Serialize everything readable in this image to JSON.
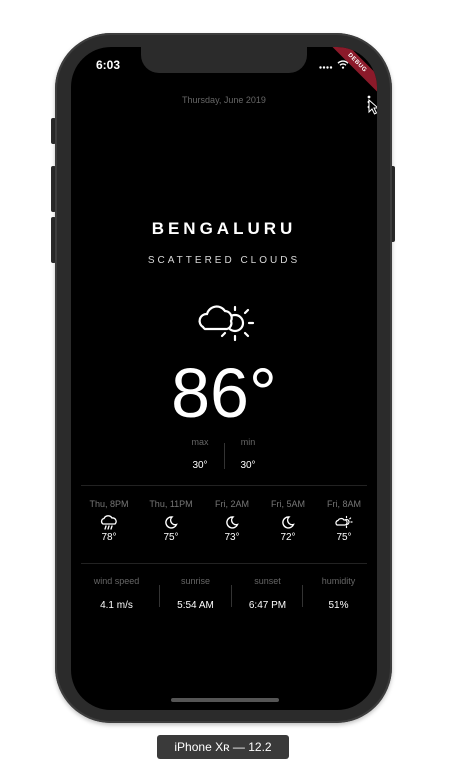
{
  "status_bar": {
    "time": "6:03",
    "debug_banner": "DEBUG"
  },
  "header": {
    "date": "Thursday, June 2019"
  },
  "current": {
    "city": "BENGALURU",
    "condition": "SCATTERED CLOUDS",
    "icon": "cloud-sun-icon",
    "temperature": "86°",
    "max_label": "max",
    "max_value": "30°",
    "min_label": "min",
    "min_value": "30°"
  },
  "forecast": [
    {
      "time": "Thu, 8PM",
      "icon": "rain-cloud-icon",
      "temp": "78°"
    },
    {
      "time": "Thu, 11PM",
      "icon": "moon-icon",
      "temp": "75°"
    },
    {
      "time": "Fri, 2AM",
      "icon": "moon-icon",
      "temp": "73°"
    },
    {
      "time": "Fri, 5AM",
      "icon": "moon-icon",
      "temp": "72°"
    },
    {
      "time": "Fri, 8AM",
      "icon": "cloud-sun-icon",
      "temp": "75°"
    }
  ],
  "stats": [
    {
      "label": "wind speed",
      "value": "4.1 m/s"
    },
    {
      "label": "sunrise",
      "value": "5:54 AM"
    },
    {
      "label": "sunset",
      "value": "6:47 PM"
    },
    {
      "label": "humidity",
      "value": "51%"
    }
  ],
  "device": {
    "label": "iPhone Xʀ — 12.2"
  },
  "colors": {
    "background": "#000000",
    "text": "#ffffff",
    "muted": "#666666",
    "debug_ribbon": "#8b1a2a"
  }
}
